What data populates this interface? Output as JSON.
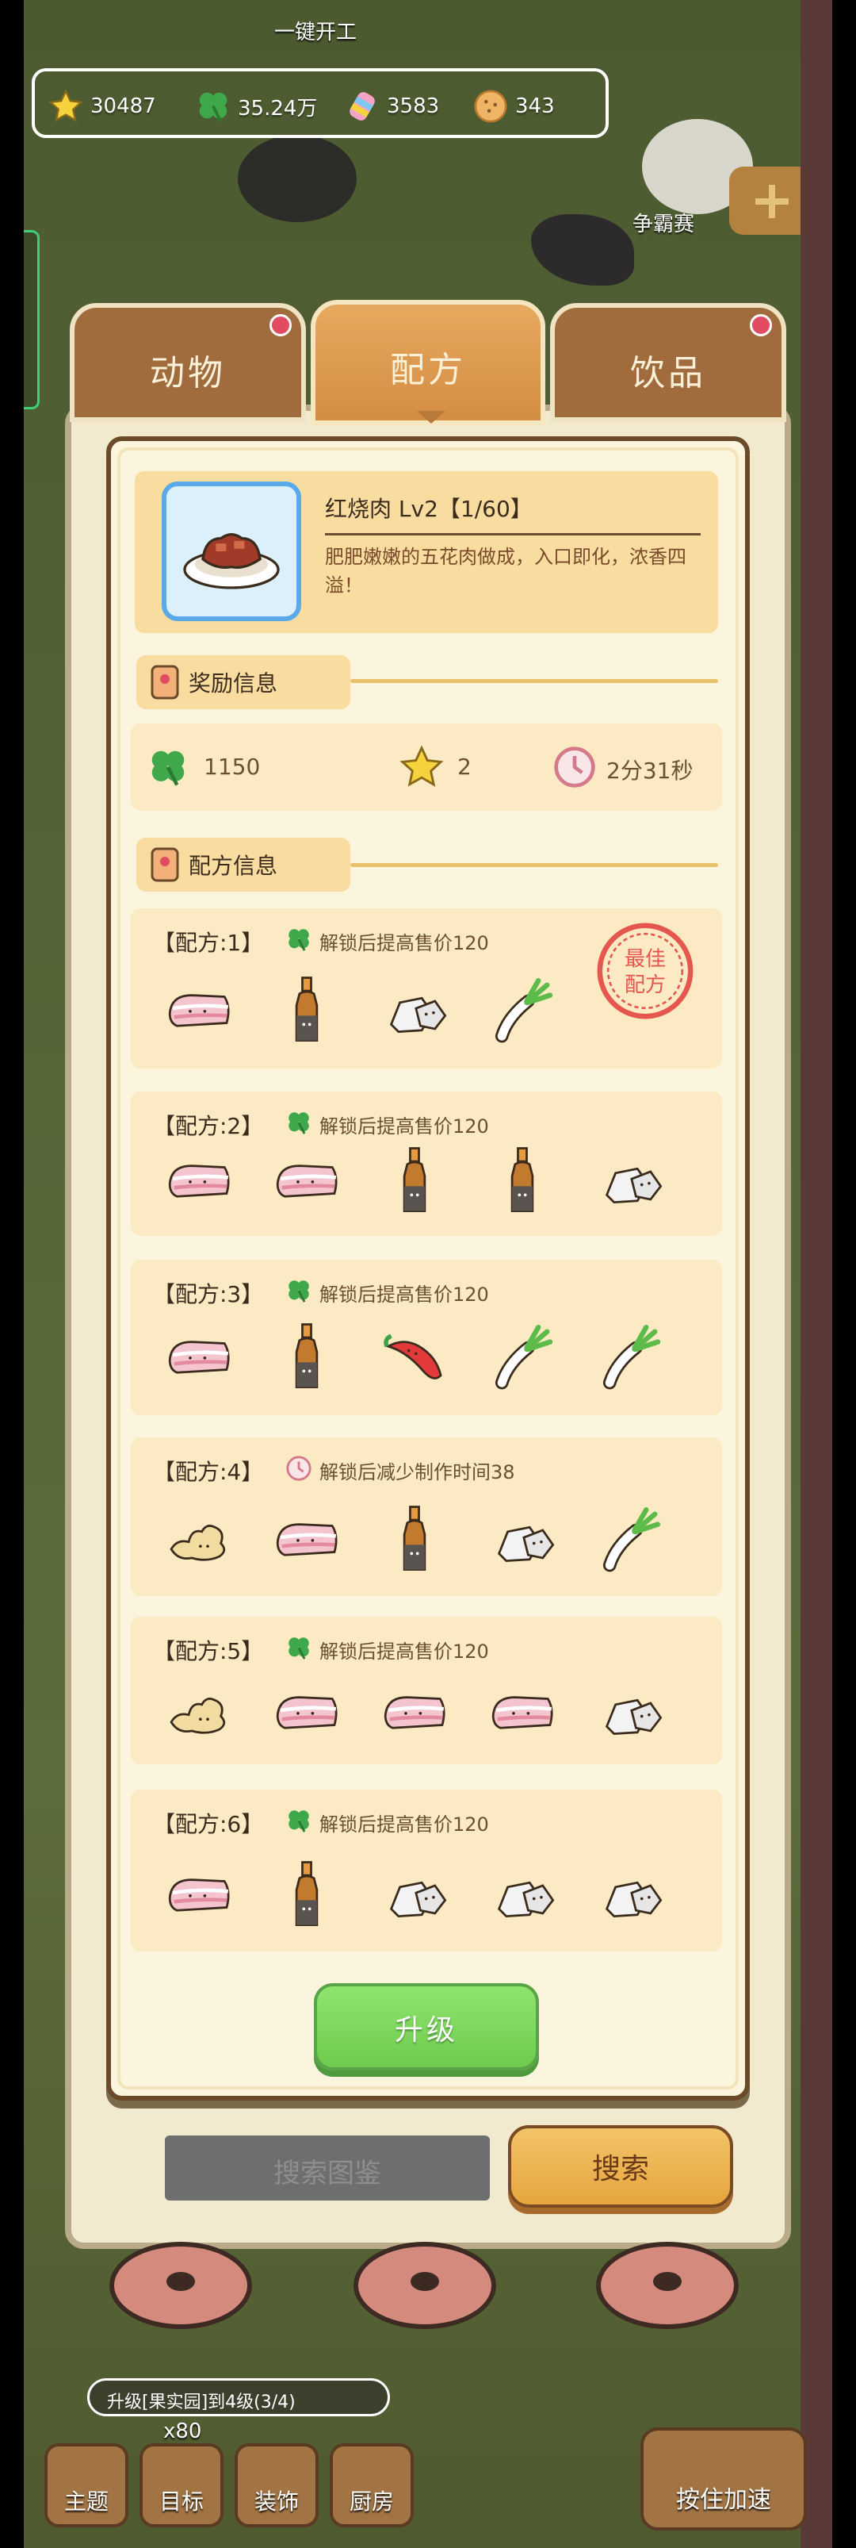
{
  "top": {
    "one_click_label": "一键开工",
    "contest_label": "争霸赛"
  },
  "resources": [
    {
      "icon": "star-icon",
      "value": "30487"
    },
    {
      "icon": "clover-icon",
      "value": "35.24万"
    },
    {
      "icon": "candy-icon",
      "value": "3583"
    },
    {
      "icon": "cookie-icon",
      "value": "343"
    }
  ],
  "tabs": [
    {
      "label": "动物",
      "active": false,
      "badge": true
    },
    {
      "label": "配方",
      "active": true,
      "badge": false
    },
    {
      "label": "饮品",
      "active": false,
      "badge": true
    }
  ],
  "recipe": {
    "title": "红烧肉 Lv2【1/60】",
    "description": "肥肥嫩嫩的五花肉做成，入口即化，浓香四溢！"
  },
  "reward_section": {
    "label": "奖励信息"
  },
  "rewards": [
    {
      "icon": "clover-icon",
      "value": "1150"
    },
    {
      "icon": "star-icon",
      "value": "2"
    },
    {
      "icon": "clock-icon",
      "value": "2分31秒"
    }
  ],
  "formula_section": {
    "label": "配方信息"
  },
  "formulas": [
    {
      "title": "【配方:1】",
      "effect_icon": "clover-icon",
      "effect": "解锁后提高售价120",
      "ingredients": [
        "pork-belly",
        "soy-sauce",
        "rock-sugar",
        "scallion"
      ],
      "best": true,
      "stamp_text": "最佳配方"
    },
    {
      "title": "【配方:2】",
      "effect_icon": "clover-icon",
      "effect": "解锁后提高售价120",
      "ingredients": [
        "pork-belly",
        "pork-belly",
        "soy-sauce",
        "soy-sauce",
        "rock-sugar"
      ],
      "best": false
    },
    {
      "title": "【配方:3】",
      "effect_icon": "clover-icon",
      "effect": "解锁后提高售价120",
      "ingredients": [
        "pork-belly",
        "soy-sauce",
        "chili",
        "scallion",
        "scallion"
      ],
      "best": false
    },
    {
      "title": "【配方:4】",
      "effect_icon": "clock-icon",
      "effect": "解锁后减少制作时间38",
      "ingredients": [
        "ginger",
        "pork-belly",
        "soy-sauce",
        "rock-sugar",
        "scallion"
      ],
      "best": false
    },
    {
      "title": "【配方:5】",
      "effect_icon": "clover-icon",
      "effect": "解锁后提高售价120",
      "ingredients": [
        "ginger",
        "pork-belly",
        "pork-belly",
        "pork-belly",
        "rock-sugar"
      ],
      "best": false
    },
    {
      "title": "【配方:6】",
      "effect_icon": "clover-icon",
      "effect": "解锁后提高售价120",
      "ingredients": [
        "pork-belly",
        "soy-sauce",
        "rock-sugar",
        "rock-sugar",
        "rock-sugar"
      ],
      "best": false
    }
  ],
  "upgrade_label": "升级",
  "search": {
    "placeholder": "搜索图鉴",
    "button_label": "搜索"
  },
  "quest": {
    "text": "升级[果实园]到4级(3/4)",
    "count": "x80"
  },
  "bottom_nav": [
    {
      "label": "主题",
      "icon": "theme-icon"
    },
    {
      "label": "目标",
      "icon": "target-icon"
    },
    {
      "label": "装饰",
      "icon": "decorate-icon"
    },
    {
      "label": "厨房",
      "icon": "kitchen-icon"
    }
  ],
  "speedup_label": "按住加速",
  "colors": {
    "panel_bg": "#fcf5de",
    "section_bg": "#f8dca0",
    "card_bg": "#fbeac4",
    "tab_active": "#e7a95f",
    "upgrade_green": "#7bd95b",
    "border_brown": "#6b4a2a"
  }
}
